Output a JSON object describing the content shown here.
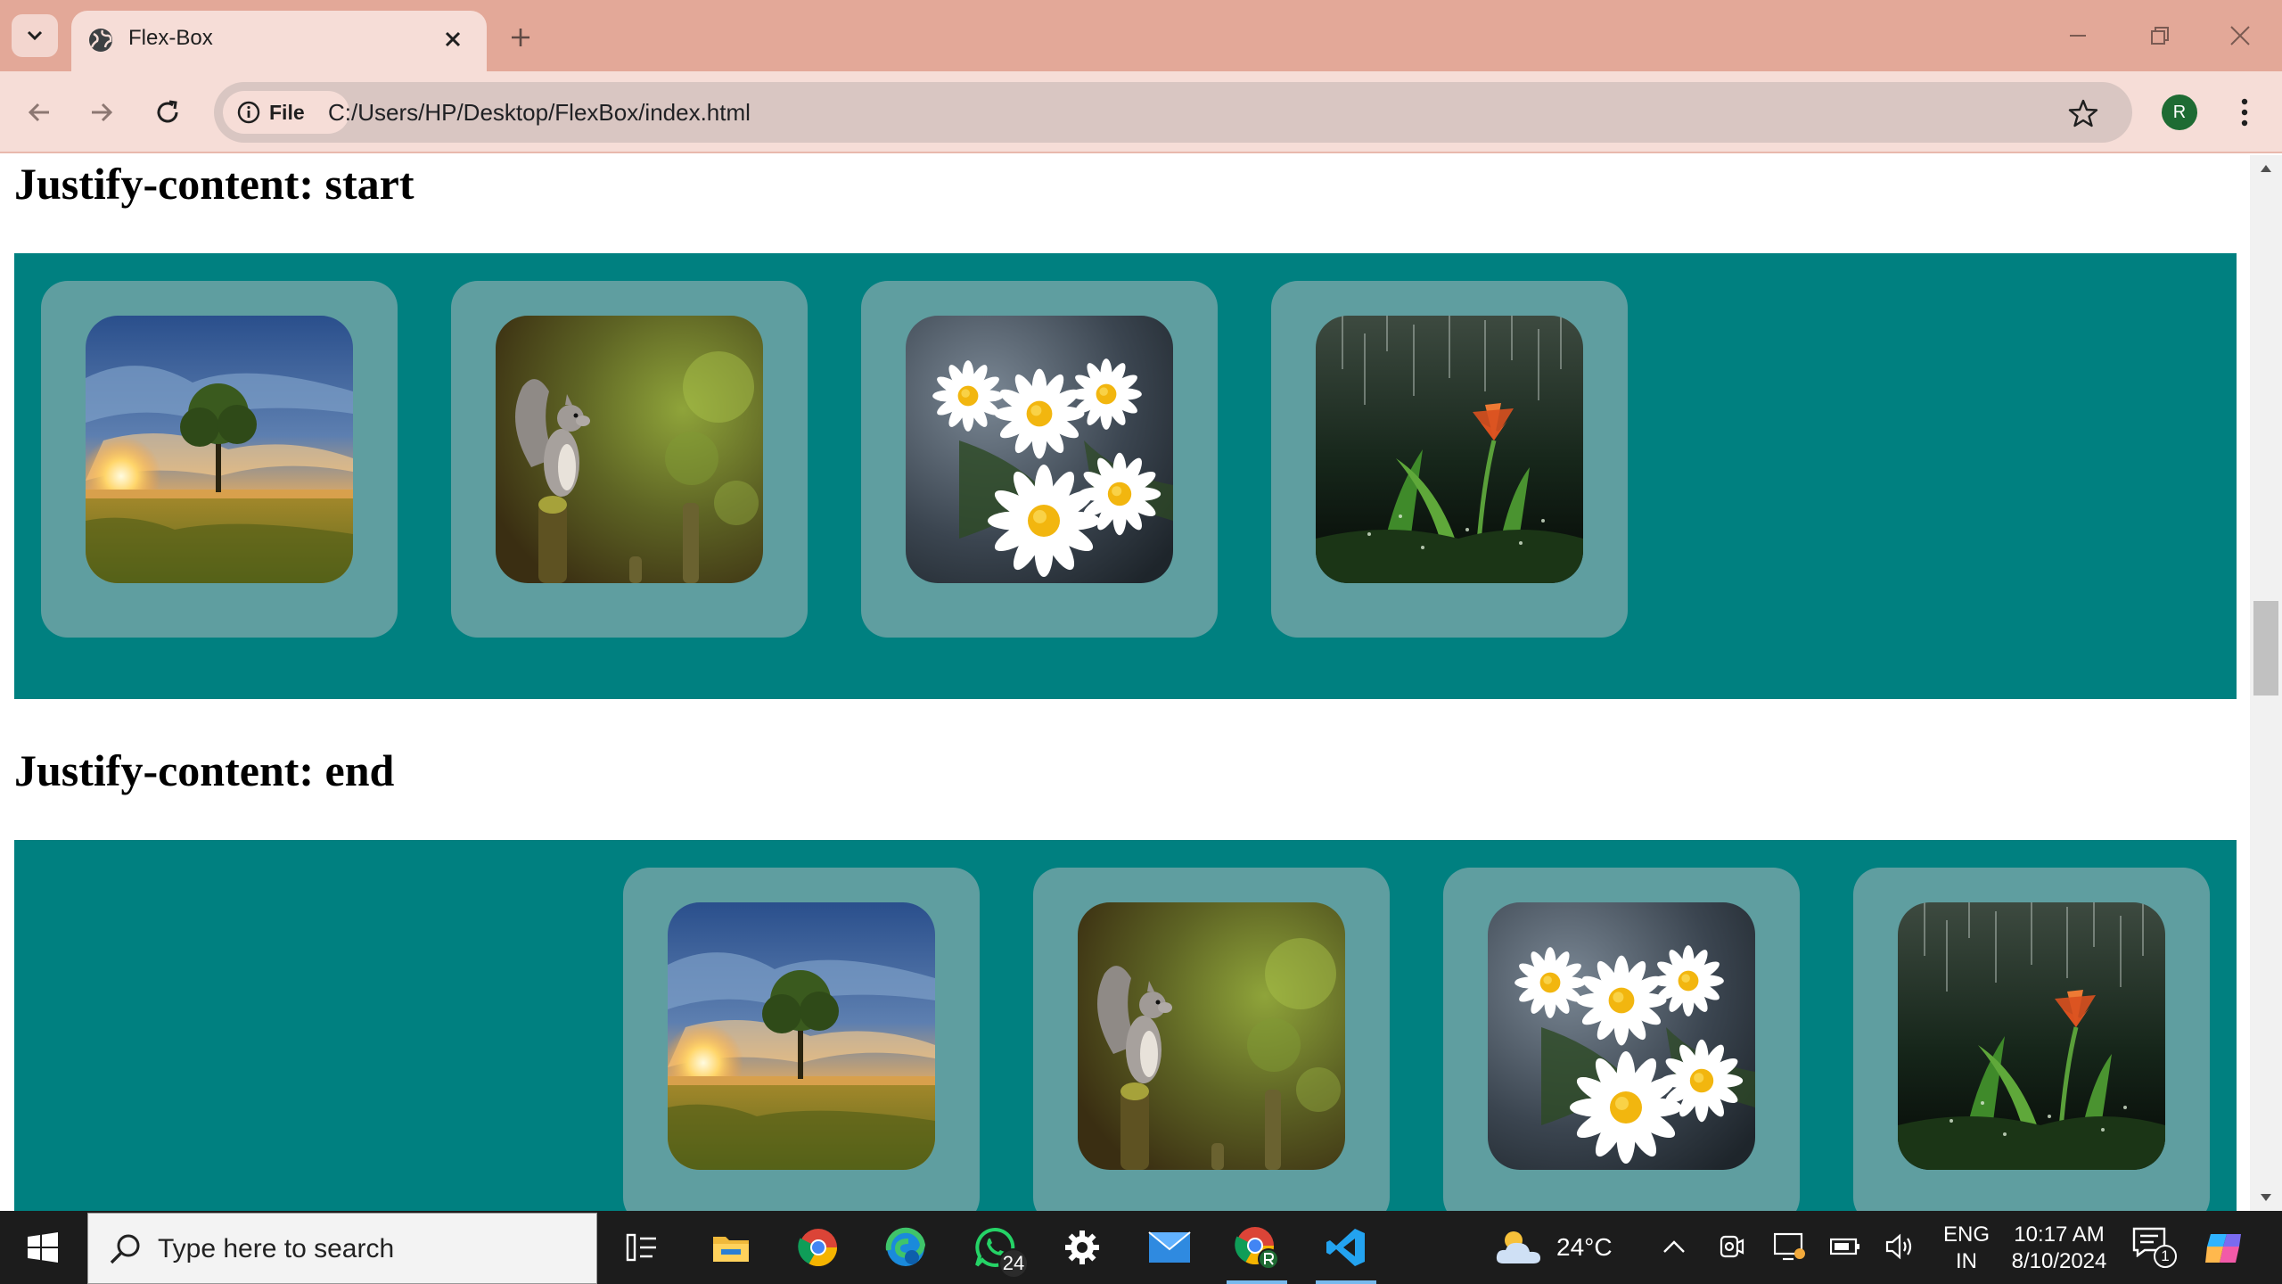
{
  "browser": {
    "tab": {
      "title": "Flex-Box"
    },
    "chip_label": "File",
    "url": "C:/Users/HP/Desktop/FlexBox/index.html",
    "profile_initial": "R"
  },
  "page": {
    "sections": [
      {
        "heading": "Justify-content: start",
        "alignment": "start",
        "images": [
          "sunset-tree",
          "squirrel",
          "daisies",
          "rain-flower"
        ]
      },
      {
        "heading": "Justify-content: end",
        "alignment": "end",
        "images": [
          "sunset-tree",
          "squirrel",
          "daisies",
          "rain-flower"
        ]
      }
    ],
    "colors": {
      "container": "#008080",
      "card": "#5f9ea0"
    }
  },
  "taskbar": {
    "search_placeholder": "Type here to search",
    "whatsapp_badge": "24",
    "weather_temp": "24°C",
    "lang_line1": "ENG",
    "lang_line2": "IN",
    "time": "10:17 AM",
    "date": "8/10/2024",
    "notification_count": "1"
  }
}
